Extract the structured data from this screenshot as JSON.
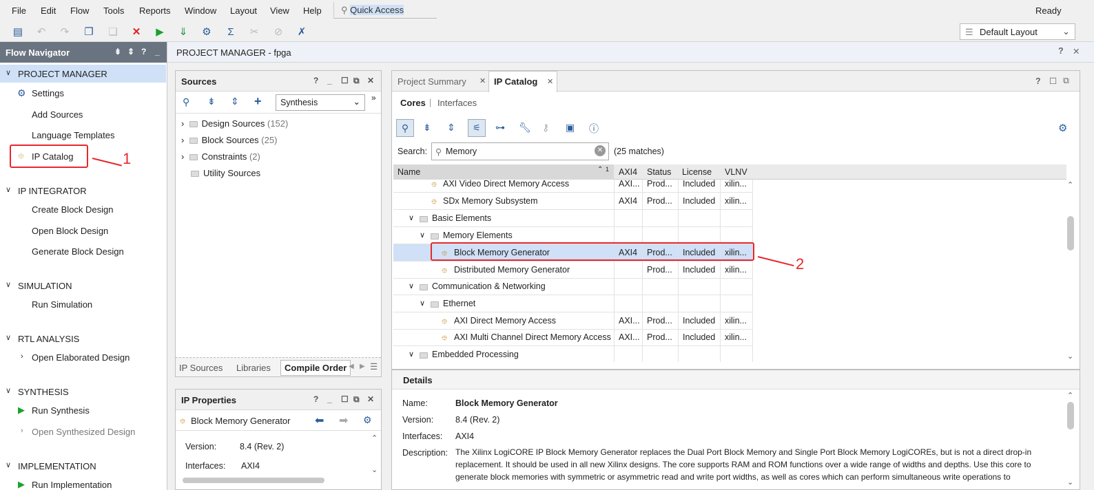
{
  "menu": [
    "File",
    "Edit",
    "Flow",
    "Tools",
    "Reports",
    "Window",
    "Layout",
    "View",
    "Help"
  ],
  "quick_access": "Quick Access",
  "status": "Ready",
  "layout_select": "Default Layout",
  "flow_nav": {
    "title": "Flow Navigator",
    "sections": [
      {
        "label": "PROJECT MANAGER",
        "items": [
          "Settings",
          "Add Sources",
          "Language Templates",
          "IP Catalog"
        ]
      },
      {
        "label": "IP INTEGRATOR",
        "items": [
          "Create Block Design",
          "Open Block Design",
          "Generate Block Design"
        ]
      },
      {
        "label": "SIMULATION",
        "items": [
          "Run Simulation"
        ]
      },
      {
        "label": "RTL ANALYSIS",
        "items": [
          "Open Elaborated Design"
        ]
      },
      {
        "label": "SYNTHESIS",
        "items": [
          "Run Synthesis",
          "Open Synthesized Design"
        ]
      },
      {
        "label": "IMPLEMENTATION",
        "items": [
          "Run Implementation"
        ]
      }
    ]
  },
  "pm_title": "PROJECT MANAGER - fpga",
  "sources": {
    "title": "Sources",
    "dropdown": "Synthesis",
    "tree": [
      {
        "label": "Design Sources",
        "count": "(152)"
      },
      {
        "label": "Block Sources",
        "count": "(25)"
      },
      {
        "label": "Constraints",
        "count": "(2)"
      },
      {
        "label": "Utility Sources",
        "count": ""
      }
    ],
    "tabs": [
      "IP Sources",
      "Libraries",
      "Compile Order"
    ]
  },
  "ip_props": {
    "title": "IP Properties",
    "name": "Block Memory Generator",
    "version_label": "Version:",
    "version": "8.4 (Rev. 2)",
    "interfaces_label": "Interfaces:",
    "interfaces": "AXI4"
  },
  "catalog": {
    "tabs": [
      "Project Summary",
      "IP Catalog"
    ],
    "subtabs": [
      "Cores",
      "Interfaces"
    ],
    "search_label": "Search:",
    "search_value": "Memory",
    "matches": "(25 matches)",
    "columns": [
      "Name",
      "AXI4",
      "Status",
      "License",
      "VLNV"
    ],
    "sort_indicator": "1",
    "rows": [
      {
        "name": "AXI Video Direct Memory Access",
        "axi": "AXI...",
        "status": "Prod...",
        "license": "Included",
        "vlnv": "xilin..."
      },
      {
        "name": "SDx Memory Subsystem",
        "axi": "AXI4",
        "status": "Prod...",
        "license": "Included",
        "vlnv": "xilin..."
      },
      {
        "name": "Basic Elements",
        "axi": "",
        "status": "",
        "license": "",
        "vlnv": ""
      },
      {
        "name": "Memory Elements",
        "axi": "",
        "status": "",
        "license": "",
        "vlnv": ""
      },
      {
        "name": "Block Memory Generator",
        "axi": "AXI4",
        "status": "Prod...",
        "license": "Included",
        "vlnv": "xilin..."
      },
      {
        "name": "Distributed Memory Generator",
        "axi": "",
        "status": "Prod...",
        "license": "Included",
        "vlnv": "xilin..."
      },
      {
        "name": "Communication & Networking",
        "axi": "",
        "status": "",
        "license": "",
        "vlnv": ""
      },
      {
        "name": "Ethernet",
        "axi": "",
        "status": "",
        "license": "",
        "vlnv": ""
      },
      {
        "name": "AXI Direct Memory Access",
        "axi": "AXI...",
        "status": "Prod...",
        "license": "Included",
        "vlnv": "xilin..."
      },
      {
        "name": "AXI Multi Channel Direct Memory Access",
        "axi": "AXI...",
        "status": "Prod...",
        "license": "Included",
        "vlnv": "xilin..."
      },
      {
        "name": "Embedded Processing",
        "axi": "",
        "status": "",
        "license": "",
        "vlnv": ""
      }
    ]
  },
  "details": {
    "title": "Details",
    "name_label": "Name:",
    "name": "Block Memory Generator",
    "version_label": "Version:",
    "version": "8.4 (Rev. 2)",
    "interfaces_label": "Interfaces:",
    "interfaces": "AXI4",
    "description_label": "Description:",
    "description_lines": [
      "The Xilinx LogiCORE IP Block Memory Generator replaces the Dual Port Block Memory and Single Port Block Memory LogiCOREs, but is not a direct drop-in",
      "replacement.  It should be used in all new Xilinx designs. The core supports RAM and ROM functions over a wide range of widths and depths. Use this core to",
      "generate block memories with symmetric or asymmetric read and write port widths, as well as cores which can perform simultaneous write operations to"
    ]
  },
  "annotations": [
    "1",
    "2"
  ],
  "colors": {
    "accent": "#1a73c8",
    "highlight": "#cfe0f7",
    "red": "#e8262c",
    "nav_head": "#6a7480"
  }
}
